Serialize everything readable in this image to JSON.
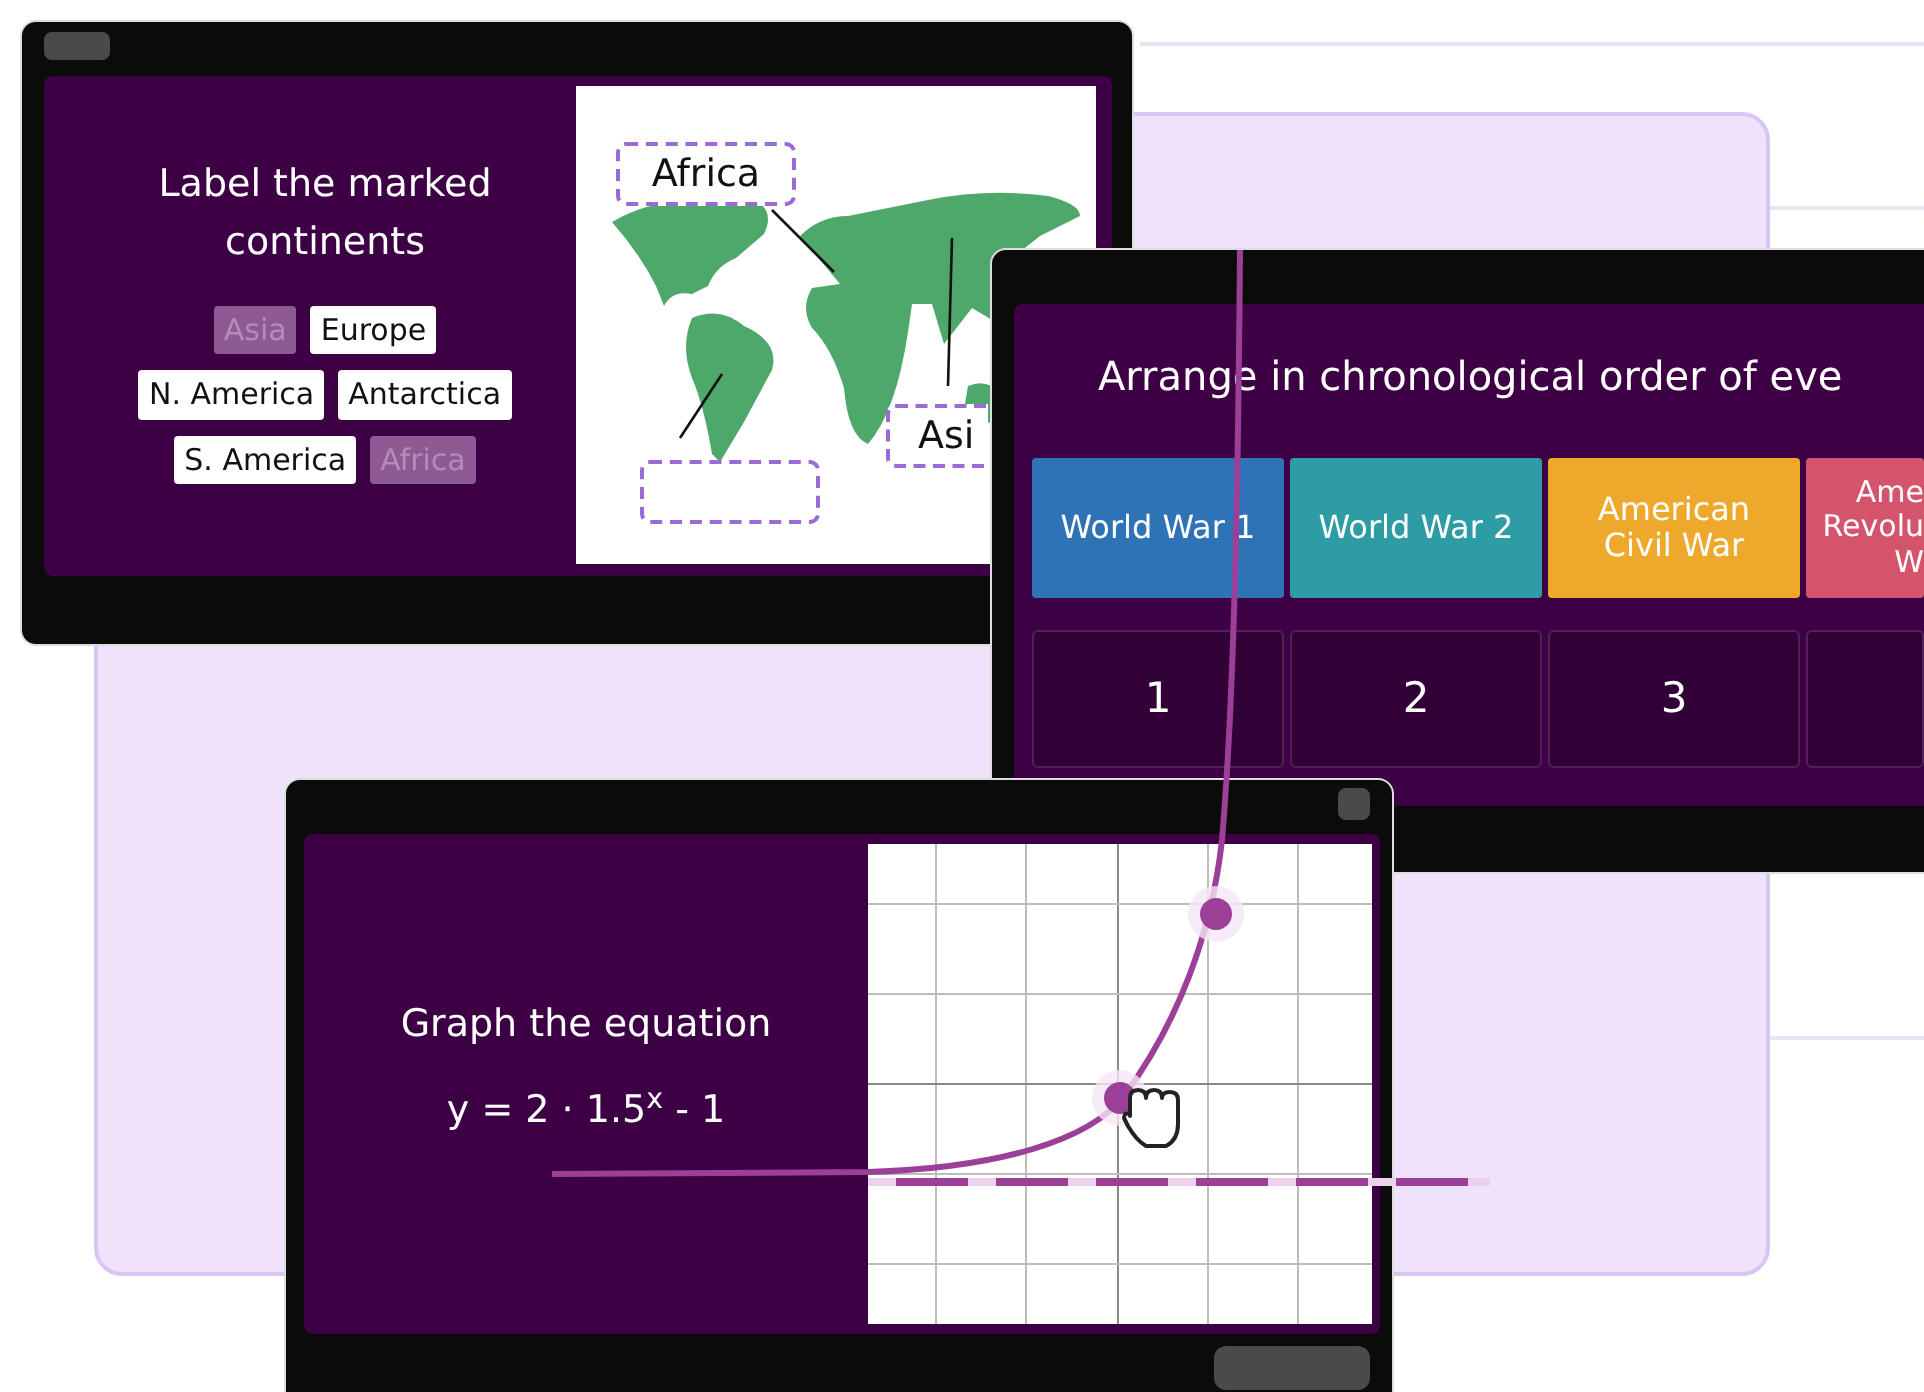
{
  "label_window": {
    "prompt": "Label the marked continents",
    "chip_rows": [
      [
        {
          "label": "Asia",
          "used": true
        },
        {
          "label": "Europe",
          "used": false
        }
      ],
      [
        {
          "label": "N. America",
          "used": false
        },
        {
          "label": "Antarctica",
          "used": false
        }
      ],
      [
        {
          "label": "S. America",
          "used": false
        },
        {
          "label": "Africa",
          "used": true
        }
      ]
    ],
    "map_labels": [
      {
        "kind": "filled",
        "text": "Africa"
      },
      {
        "kind": "empty"
      },
      {
        "kind": "filled",
        "text": "Asi"
      }
    ]
  },
  "order_window": {
    "prompt": "Arrange in chronological order of eve",
    "cards": [
      {
        "lines": [
          "World War 1"
        ],
        "color": "#2f73b7"
      },
      {
        "lines": [
          "World War 2"
        ],
        "color": "#2d9ca4"
      },
      {
        "lines": [
          "American",
          "Civil War"
        ],
        "color": "#eea92c"
      },
      {
        "lines": [
          "Ame",
          "Revolu",
          "W"
        ],
        "color": "#d4546b"
      }
    ],
    "slots": [
      {
        "kind": "numbered",
        "number": "1"
      },
      {
        "kind": "numbered",
        "number": "2"
      },
      {
        "kind": "numbered",
        "number": "3"
      },
      {
        "kind": "cut"
      }
    ]
  },
  "graph_window": {
    "prompt": "Graph the equation",
    "equation": "y = 2 · 1.5$^{x}$ - 1"
  }
}
